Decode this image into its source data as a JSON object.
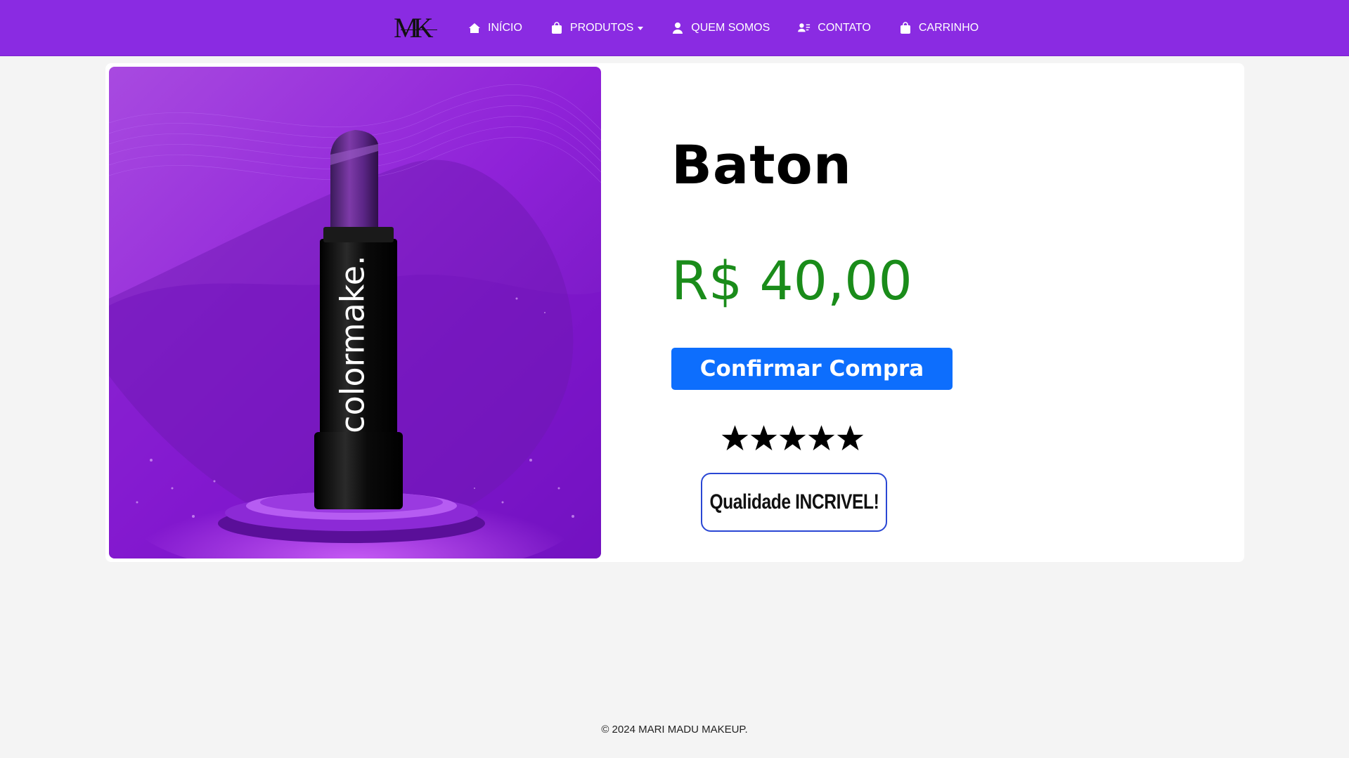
{
  "nav": {
    "logo_text": "MK",
    "items": [
      {
        "label": "INÍCIO",
        "icon": "home-icon"
      },
      {
        "label": "PRODUTOS",
        "icon": "bag-icon",
        "dropdown": true
      },
      {
        "label": "QUEM SOMOS",
        "icon": "user-icon"
      },
      {
        "label": "CONTATO",
        "icon": "contact-icon"
      },
      {
        "label": "CARRINHO",
        "icon": "bag-icon"
      }
    ]
  },
  "product": {
    "brand_on_image": "colormake.",
    "title": "Baton",
    "price": "R$ 40,00",
    "buy_label": "Confirmar Compra",
    "rating": 5,
    "rating_max": 5,
    "badge_text": "Qualidade INCRIVEL!"
  },
  "footer": {
    "copyright": "© 2024 MARI MADU MAKEUP."
  },
  "colors": {
    "navbar": "#8a2be2",
    "price": "#1a8c1a",
    "button": "#0d6efd",
    "badge_border": "#2a47d4"
  }
}
